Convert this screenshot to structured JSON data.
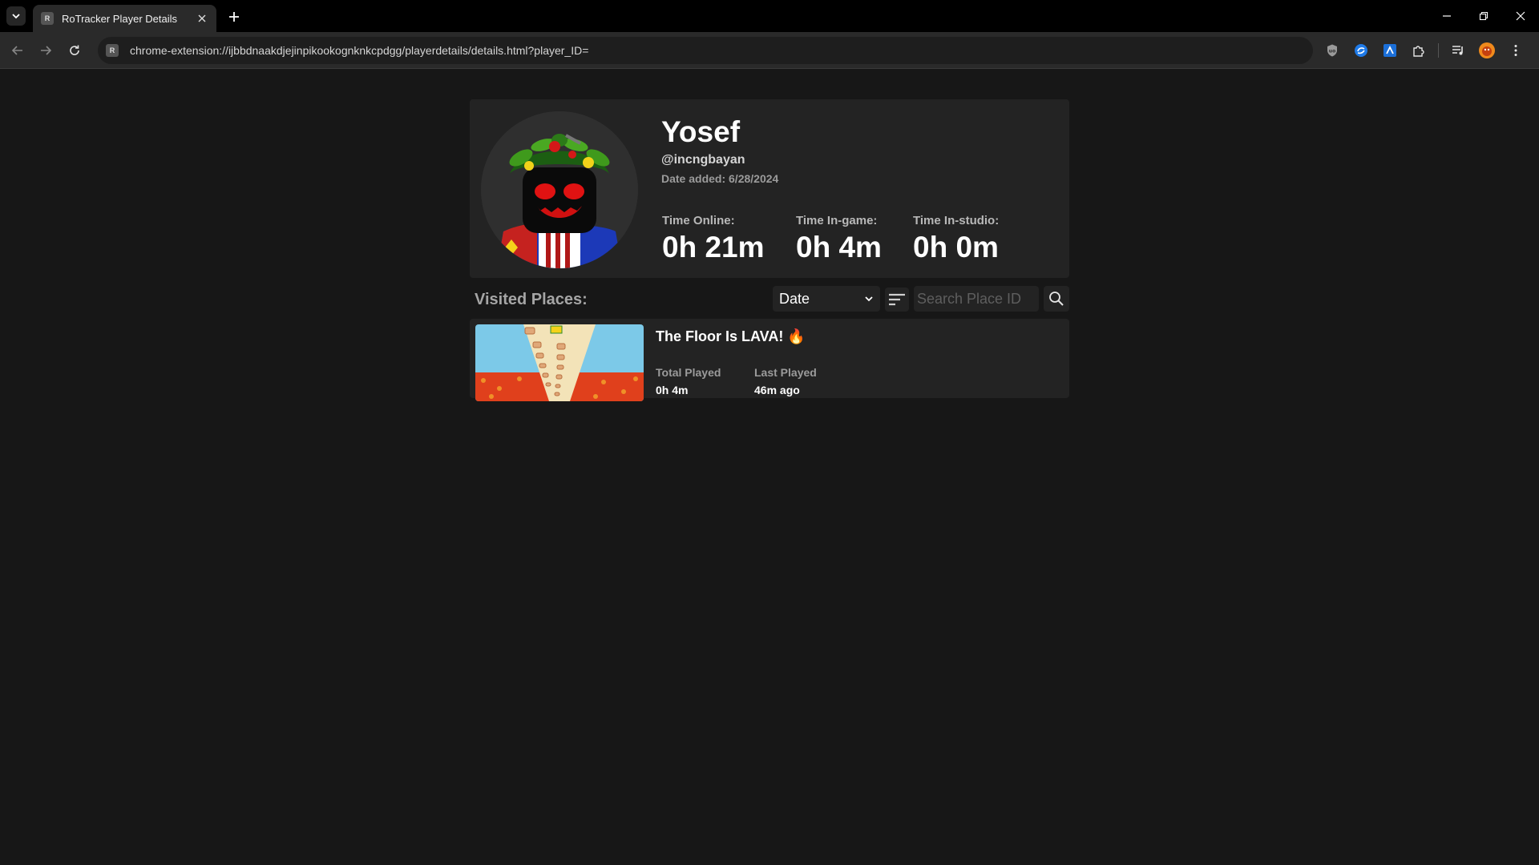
{
  "browser": {
    "tab_title": "RoTracker Player Details",
    "favicon_letter": "R",
    "url": "chrome-extension://ijbbdnaakdjejinpikookognknkcpdgg/playerdetails/details.html?player_ID=",
    "extensions": [
      "shield-extension-icon",
      "circle-extension-icon",
      "roblox-extension-icon",
      "puzzle-extensions-icon",
      "media-control-icon",
      "profile-avatar-icon"
    ]
  },
  "profile": {
    "display_name": "Yosef",
    "username": "@incngbayan",
    "date_added": "Date added: 6/28/2024",
    "stats": [
      {
        "label": "Time Online:",
        "value": "0h 21m"
      },
      {
        "label": "Time In-game:",
        "value": "0h 4m"
      },
      {
        "label": "Time In-studio:",
        "value": "0h 0m"
      }
    ]
  },
  "places_section": {
    "title": "Visited Places:",
    "sort_value": "Date",
    "search_placeholder": "Search Place ID"
  },
  "places": [
    {
      "name": "The Floor Is LAVA! 🔥",
      "total_played_label": "Total Played",
      "total_played": "0h 4m",
      "last_played_label": "Last Played",
      "last_played": "46m ago"
    }
  ],
  "colors": {
    "page_bg": "#171717",
    "card_bg": "#232323",
    "lava": "#e0401c",
    "sky": "#7cc9e8"
  }
}
